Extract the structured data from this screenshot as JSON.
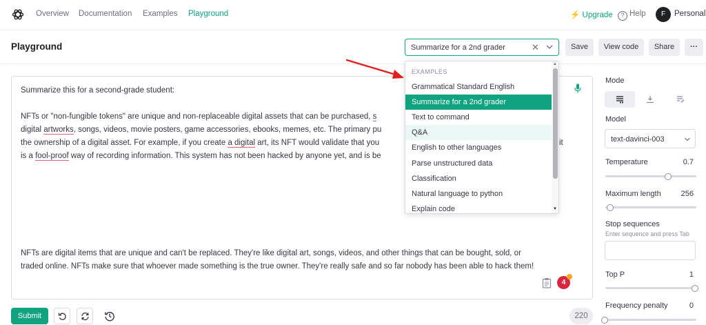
{
  "nav": {
    "links": [
      "Overview",
      "Documentation",
      "Examples",
      "Playground"
    ],
    "active": "Playground",
    "upgrade": "Upgrade",
    "help": "Help",
    "avatar_initial": "F",
    "account": "Personal"
  },
  "header": {
    "title": "Playground",
    "preset_value": "Summarize for a 2nd grader",
    "save": "Save",
    "view_code": "View code",
    "share": "Share",
    "more": "···"
  },
  "editor": {
    "line1": "Summarize this for a second-grade student:",
    "p1_l1a": "NFTs or \"non-fungible tokens\" are unique and non-replaceable digital assets that can be purchased, ",
    "p1_l1b": "s",
    "p1_l2a": "digital ",
    "p1_l2b": "artworks",
    "p1_l2c": ", songs, videos, movie posters, game accessories, ebooks, memes, etc. The primary pu",
    "p1_l3a": "the ownership of a digital asset. For example, if you create ",
    "p1_l3b": "a digital",
    "p1_l3c": " art, its NFT would validate that you",
    "p1_l3d": "it",
    "p1_l4a": "is a ",
    "p1_l4b": "fool-proof",
    "p1_l4c": " way of recording information. This system has not been hacked by anyone yet, and is be",
    "out_l1": "NFTs are digital items that are unique and can't be replaced. They're like digital art, songs, videos, and other things that can be bought, sold, or",
    "out_l2": "traded online. NFTs make sure that whoever made something is the true owner. They're really safe and so far nobody has been able to hack them!",
    "badge_count": "4"
  },
  "dropdown": {
    "header": "EXAMPLES",
    "items": [
      "Grammatical Standard English",
      "Summarize for a 2nd grader",
      "Text to command",
      "Q&A",
      "English to other languages",
      "Parse unstructured data",
      "Classification",
      "Natural language to python",
      "Explain code"
    ],
    "selected": "Summarize for a 2nd grader",
    "hovered": "Q&A"
  },
  "footer": {
    "submit": "Submit",
    "token_count": "220"
  },
  "settings": {
    "mode_label": "Mode",
    "model_label": "Model",
    "model_value": "text-davinci-003",
    "temperature_label": "Temperature",
    "temperature_value": "0.7",
    "max_length_label": "Maximum length",
    "max_length_value": "256",
    "stop_label": "Stop sequences",
    "stop_hint": "Enter sequence and press Tab",
    "top_p_label": "Top P",
    "top_p_value": "1",
    "freq_label": "Frequency penalty",
    "freq_value": "0"
  },
  "colors": {
    "accent": "#10a37f",
    "arrow": "#e0201c",
    "badge": "#d7263d"
  }
}
